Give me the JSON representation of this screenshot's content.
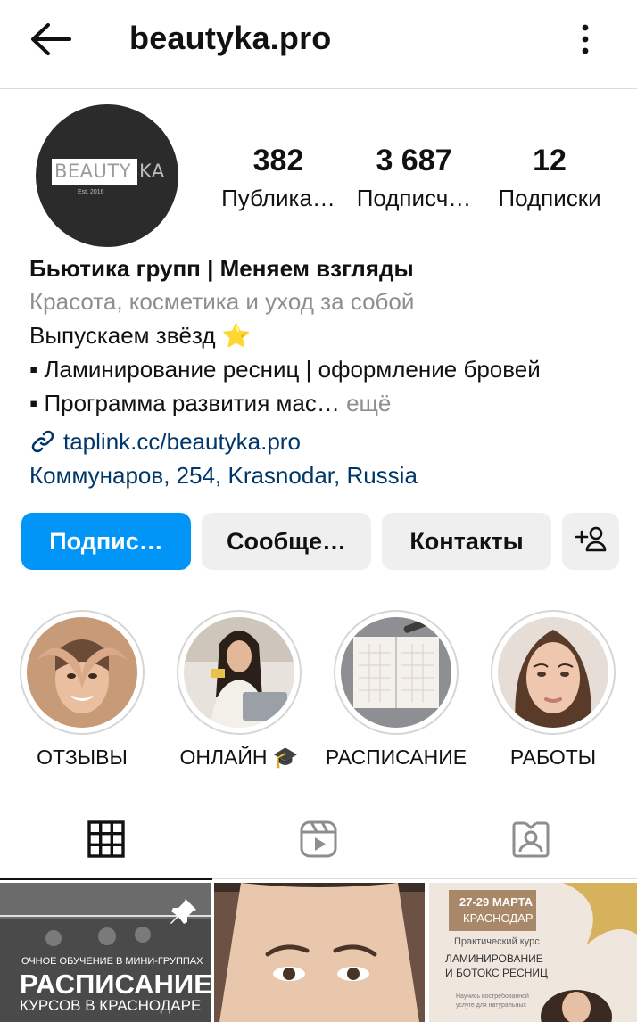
{
  "header": {
    "username": "beautyka.pro",
    "back_icon": "arrow-left-icon",
    "more_icon": "vertical-dots-icon"
  },
  "avatar": {
    "logo_part1": "BEAUTY",
    "logo_part2": "KA",
    "logo_est": "Est. 2016"
  },
  "stats": [
    {
      "value": "382",
      "label": "Публика…"
    },
    {
      "value": "3 687",
      "label": "Подписч…"
    },
    {
      "value": "12",
      "label": "Подписки"
    }
  ],
  "bio": {
    "name": "Бьютика групп | Меняем взгляды",
    "category": "Красота, косметика и уход за собой",
    "line1": "Выпускаем звёзд ⭐",
    "line2": "▪ Ламинирование ресниц | оформление бровей",
    "line3": "▪ Программа развития мас…",
    "more": " ещё",
    "link": "taplink.cc/beautyka.pro",
    "address": "Коммунаров, 254, Krasnodar, Russia"
  },
  "buttons": {
    "follow": "Подпис…",
    "message": "Сообще…",
    "contacts": "Контакты",
    "add_user_icon": "add-person-icon"
  },
  "highlights": [
    {
      "label": "ОТЗЫВЫ"
    },
    {
      "label": "ОНЛАЙН 🎓"
    },
    {
      "label": "РАСПИСАНИЕ"
    },
    {
      "label": "РАБОТЫ"
    }
  ],
  "tabs": [
    {
      "icon": "grid-icon",
      "active": true
    },
    {
      "icon": "reels-icon",
      "active": false
    },
    {
      "icon": "tagged-icon",
      "active": false
    }
  ],
  "posts": {
    "p1_top": "ОЧНОЕ ОБУЧЕНИЕ В МИНИ-ГРУППАХ",
    "p1_title": "РАСПИСАНИЕ",
    "p1_sub": "КУРСОВ В КРАСНОДАРЕ",
    "p3_date": "27-29 МАРТА",
    "p3_city": "КРАСНОДАР",
    "p3_kind": "Практический курс",
    "p3_title1": "ЛАМИНИРОВАНИЕ",
    "p3_title2": "И БОТОКС РЕСНИЦ",
    "p3_small1": "Научись востребованной",
    "p3_small2": "услуге для натуральных"
  },
  "colors": {
    "accent": "#0095f6",
    "link": "#00376b",
    "muted": "#8e8e8e",
    "button_bg": "#efefef"
  }
}
